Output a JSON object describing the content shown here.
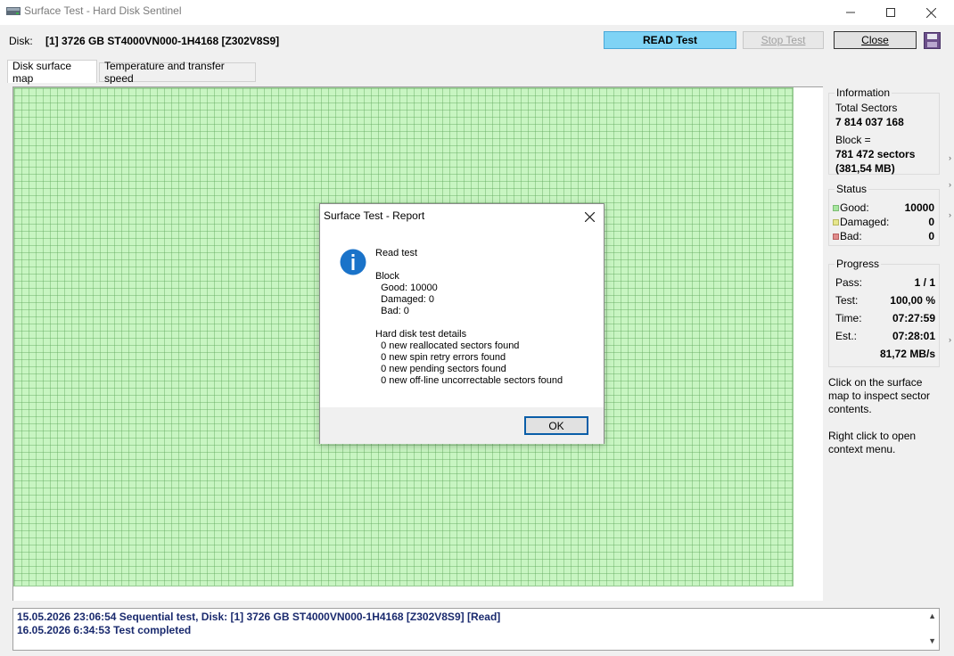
{
  "window": {
    "title": "Surface Test - Hard Disk Sentinel"
  },
  "toolbar": {
    "disk_label": "Disk:",
    "disk_value": "[1] 3726 GB  ST4000VN000-1H4168 [Z302V8S9]",
    "read_test": "READ Test",
    "stop_test": "Stop Test",
    "close": "Close"
  },
  "tabs": [
    {
      "label": "Disk surface map"
    },
    {
      "label": "Temperature and transfer speed"
    }
  ],
  "information": {
    "title": "Information",
    "total_sectors_label": "Total Sectors",
    "total_sectors_value": "7 814 037 168",
    "block_label": "Block =",
    "block_sectors": "781 472 sectors",
    "block_size": "(381,54 MB)"
  },
  "status": {
    "title": "Status",
    "rows": [
      {
        "label": "Good:",
        "value": "10000",
        "color": "#a8e6a0"
      },
      {
        "label": "Damaged:",
        "value": "0",
        "color": "#e6e68c"
      },
      {
        "label": "Bad:",
        "value": "0",
        "color": "#e08c8c"
      }
    ]
  },
  "progress": {
    "title": "Progress",
    "rows": [
      {
        "label": "Pass:",
        "value": "1 / 1"
      },
      {
        "label": "Test:",
        "value": "100,00 %"
      },
      {
        "label": "Time:",
        "value": "07:27:59"
      },
      {
        "label": "Est.:",
        "value": "07:28:01"
      },
      {
        "label": "",
        "value": "81,72 MB/s"
      }
    ]
  },
  "hints": {
    "line1": "Click on the surface map to inspect sector contents.",
    "line2": "Right click to open context menu."
  },
  "log": [
    "15.05.2026  23:06:54   Sequential test, Disk: [1] 3726 GB  ST4000VN000-1H4168 [Z302V8S9] [Read]",
    "16.05.2026  6:34:53   Test completed"
  ],
  "dialog": {
    "title": "Surface Test - Report",
    "body": "Read test\n\nBlock\n  Good: 10000\n  Damaged: 0\n  Bad: 0\n\nHard disk test details\n  0 new reallocated sectors found\n  0 new spin retry errors found\n  0 new pending sectors found\n  0 new off-line uncorrectable sectors found",
    "ok": "OK"
  },
  "colors": {
    "read_button": "#7fd3f5",
    "map_fill": "#c8f5c2",
    "log_text": "#1a2a6e",
    "info_icon": "#1a73c9"
  }
}
